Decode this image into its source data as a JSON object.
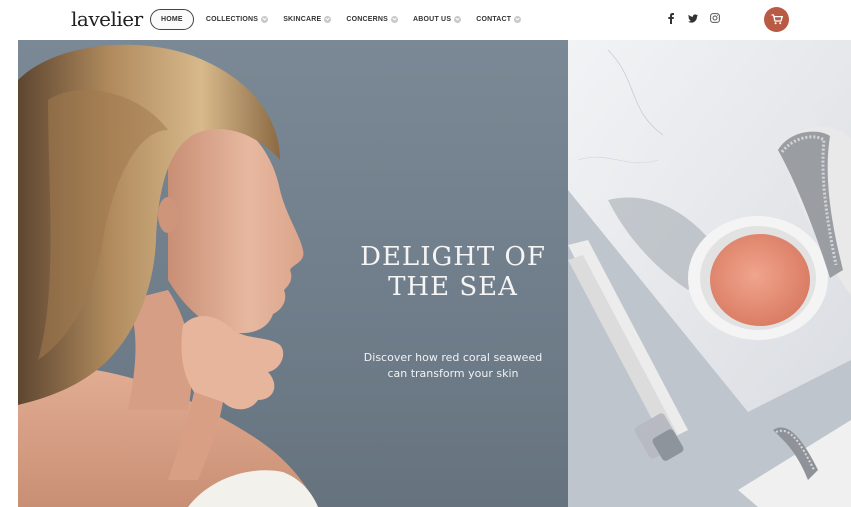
{
  "brand": {
    "logo_text": "lavelier"
  },
  "nav": {
    "items": [
      {
        "label": "HOME",
        "active": true
      },
      {
        "label": "COLLECTIONS",
        "active": false
      },
      {
        "label": "SKINCARE",
        "active": false
      },
      {
        "label": "CONCERNS",
        "active": false
      },
      {
        "label": "ABOUT US",
        "active": false
      },
      {
        "label": "CONTACT",
        "active": false
      }
    ]
  },
  "social": {
    "icons": [
      "facebook-icon",
      "twitter-icon",
      "instagram-icon"
    ],
    "glyphs": {
      "facebook": "f",
      "twitter": "✦",
      "instagram": "◎"
    }
  },
  "cart": {
    "icon": "cart-icon",
    "color": "#b85a44"
  },
  "hero": {
    "title_line1": "DELIGHT OF",
    "title_line2": "THE SEA",
    "subtitle_line1": "Discover how red coral seaweed",
    "subtitle_line2": "can transform your skin",
    "background_color": "#7b8996"
  }
}
